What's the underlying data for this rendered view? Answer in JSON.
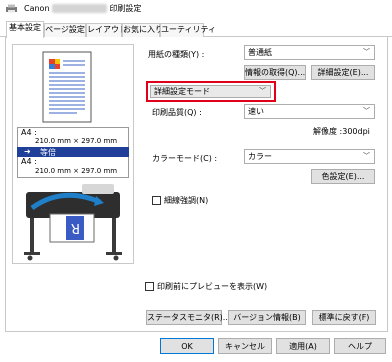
{
  "window": {
    "app_name": "Canon",
    "title_suffix": "印刷設定"
  },
  "tabs": [
    {
      "label": "基本設定",
      "active": true
    },
    {
      "label": "ページ設定"
    },
    {
      "label": "レイアウト"
    },
    {
      "label": "お気に入り"
    },
    {
      "label": "ユーティリティ"
    }
  ],
  "preview": {
    "source_size_label": "A4 :",
    "source_size_value": "210.0 mm × 297.0 mm",
    "scale_label": "等倍",
    "dest_size_label": "A4 :",
    "dest_size_value": "210.0 mm × 297.0 mm",
    "printer_image_icon": "printer-illustration"
  },
  "media": {
    "label": "用紙の種類(Y) :",
    "value": "普通紙",
    "info_button": "情報の取得(Q)...",
    "detail_button": "詳細設定(E)..."
  },
  "mode": {
    "value": "詳細設定モード",
    "highlight_color": "#e0001b"
  },
  "quality": {
    "label": "印刷品質(Q) :",
    "value": "速い",
    "resolution_text": "解像度 :300dpi"
  },
  "color": {
    "label": "カラーモード(C) :",
    "value": "カラー",
    "settings_button": "色設定(E)..."
  },
  "fine_line": {
    "label": "細線強調(N)",
    "checked": false
  },
  "preview_before_print": {
    "label": "印刷前にプレビューを表示(W)",
    "checked": false
  },
  "bottom_buttons": {
    "status_monitor": "ステータスモニタ(R)...",
    "version_info": "バージョン情報(B)",
    "defaults": "標準に戻す(F)"
  },
  "dialog_buttons": {
    "ok": "OK",
    "cancel": "キャンセル",
    "apply": "適用(A)",
    "help": "ヘルプ"
  }
}
